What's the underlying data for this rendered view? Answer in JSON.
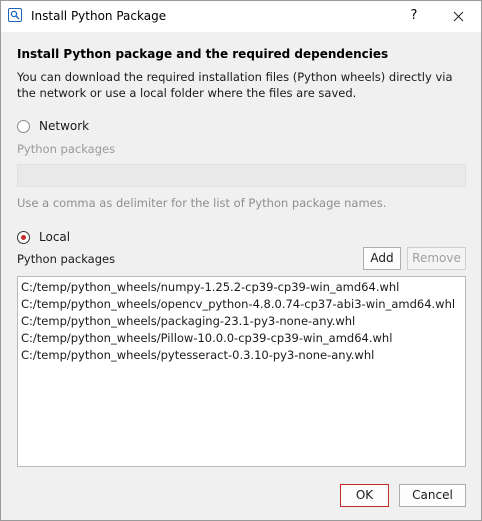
{
  "window": {
    "title": "Install Python Package",
    "help_label": "?",
    "app_icon": "search-icon",
    "close_icon": "close-icon"
  },
  "heading": "Install Python package and the required dependencies",
  "description": "You can download the required installation files (Python wheels) directly via the network or use a local folder where the files are saved.",
  "network": {
    "label": "Network",
    "selected": false,
    "packages_label": "Python packages",
    "packages_value": "",
    "hint": "Use a comma as delimiter for the list of Python package names."
  },
  "local": {
    "label": "Local",
    "selected": true,
    "packages_label": "Python packages",
    "add_label": "Add",
    "remove_label": "Remove",
    "files": [
      "C:/temp/python_wheels/numpy-1.25.2-cp39-cp39-win_amd64.whl",
      "C:/temp/python_wheels/opencv_python-4.8.0.74-cp37-abi3-win_amd64.whl",
      "C:/temp/python_wheels/packaging-23.1-py3-none-any.whl",
      "C:/temp/python_wheels/Pillow-10.0.0-cp39-cp39-win_amd64.whl",
      "C:/temp/python_wheels/pytesseract-0.3.10-py3-none-any.whl"
    ]
  },
  "footer": {
    "ok_label": "OK",
    "cancel_label": "Cancel"
  },
  "colors": {
    "accent": "#c42b2b",
    "icon_blue": "#1f64b8"
  }
}
